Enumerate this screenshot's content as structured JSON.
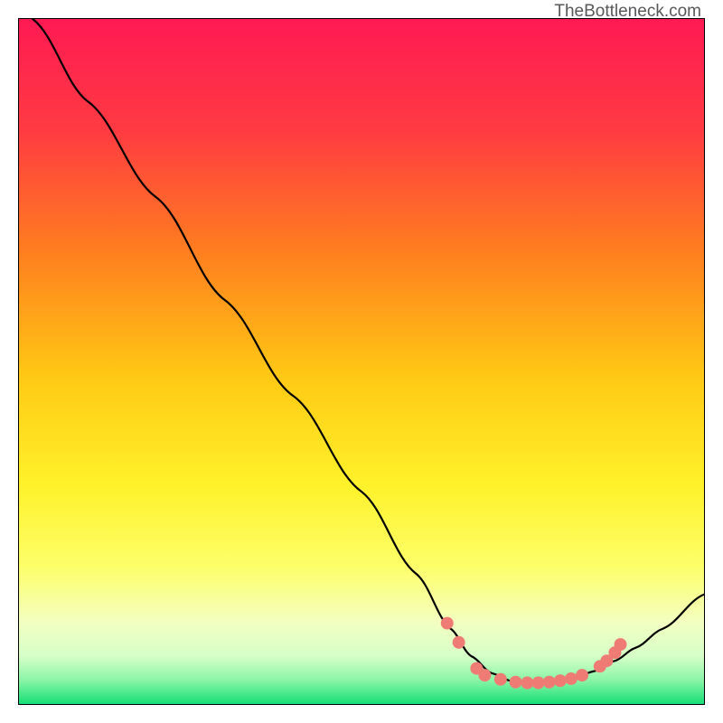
{
  "watermark": "TheBottleneck.com",
  "chart_data": {
    "type": "line",
    "title": "",
    "xlabel": "",
    "ylabel": "",
    "xlim": [
      0,
      100
    ],
    "ylim": [
      0,
      100
    ],
    "background_gradient": {
      "top": "#ff1a53",
      "mid1": "#ff8a00",
      "mid2": "#fff600",
      "mid3": "#f8ffb0",
      "bottom": "#18e07a"
    },
    "curve": {
      "comment": "Approximate V-shaped bottleneck curve; y=100 at x=0, minimum ~3 near x≈74, rises to ~15 at x=100",
      "points": [
        {
          "x": 2,
          "y": 100
        },
        {
          "x": 10,
          "y": 88
        },
        {
          "x": 20,
          "y": 74
        },
        {
          "x": 30,
          "y": 59
        },
        {
          "x": 40,
          "y": 45
        },
        {
          "x": 50,
          "y": 31
        },
        {
          "x": 58,
          "y": 19
        },
        {
          "x": 63,
          "y": 11
        },
        {
          "x": 66,
          "y": 7
        },
        {
          "x": 69,
          "y": 4.5
        },
        {
          "x": 72,
          "y": 3.3
        },
        {
          "x": 75,
          "y": 3
        },
        {
          "x": 78,
          "y": 3.2
        },
        {
          "x": 81,
          "y": 3.8
        },
        {
          "x": 84,
          "y": 4.8
        },
        {
          "x": 87,
          "y": 6.3
        },
        {
          "x": 90,
          "y": 8.2
        },
        {
          "x": 94,
          "y": 11
        },
        {
          "x": 100,
          "y": 16
        }
      ]
    },
    "markers": {
      "comment": "Salmon dots clustered around the minimum of the curve",
      "points": [
        {
          "x": 62.5,
          "y": 11.8
        },
        {
          "x": 64.2,
          "y": 9.0
        },
        {
          "x": 66.8,
          "y": 5.2
        },
        {
          "x": 68.0,
          "y": 4.2
        },
        {
          "x": 70.3,
          "y": 3.6
        },
        {
          "x": 72.5,
          "y": 3.2
        },
        {
          "x": 74.2,
          "y": 3.1
        },
        {
          "x": 75.8,
          "y": 3.1
        },
        {
          "x": 77.4,
          "y": 3.2
        },
        {
          "x": 79.0,
          "y": 3.4
        },
        {
          "x": 80.6,
          "y": 3.7
        },
        {
          "x": 82.2,
          "y": 4.2
        },
        {
          "x": 84.8,
          "y": 5.5
        },
        {
          "x": 85.8,
          "y": 6.3
        },
        {
          "x": 87.0,
          "y": 7.5
        },
        {
          "x": 87.8,
          "y": 8.7
        }
      ],
      "color": "#ee7b74",
      "radius_px": 7
    }
  }
}
